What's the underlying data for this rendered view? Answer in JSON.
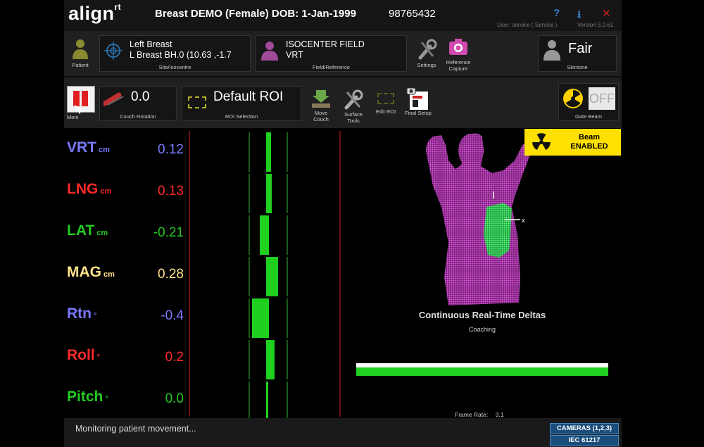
{
  "app": {
    "logo": "align",
    "logo_sup": "rt",
    "patient_title": "Breast DEMO (Female) DOB: 1-Jan-1999",
    "patient_id": "98765432",
    "user_info": "User: service  ( Service )",
    "version": "Version 5.0.61",
    "help_glyph": "?",
    "download_glyph": "⭳",
    "close_glyph": "✕"
  },
  "toolbar1": {
    "patient_label": "Patient",
    "site_line1": "Left Breast",
    "site_line2": "L Breast BH.0  (10.63 ,-1.7",
    "site_label": "Site/Isocentre",
    "field_line1": "ISOCENTER FIELD",
    "field_line2": "VRT",
    "field_label": "Field/Reference",
    "settings_label": "Settings",
    "refcap_label1": "Reference",
    "refcap_label2": "Capture",
    "skintone_value": "Fair",
    "skintone_label": "Skintone"
  },
  "toolbar2": {
    "monitor_label": "Moni",
    "couch_rotation_value": "0.0",
    "couch_rotation_label": "Couch Rotation",
    "roi_value": "Default ROI",
    "roi_label": "ROI Selection",
    "move_couch_1": "Move",
    "move_couch_2": "Couch",
    "surface_tools_1": "Surface",
    "surface_tools_2": "Tools",
    "edit_roi": "Edit ROI",
    "final_setup": "Final Setup",
    "gate_off": "OFF",
    "gate_label": "Gate Beam"
  },
  "metrics": [
    {
      "label": "VRT",
      "unit": "cm",
      "value": "0.12",
      "color": "#7a7aff",
      "bar": 0.12
    },
    {
      "label": "LNG",
      "unit": "cm",
      "value": "0.13",
      "color": "#ff2a2a",
      "bar": 0.13
    },
    {
      "label": "LAT",
      "unit": "cm",
      "value": "-0.21",
      "color": "#22cc22",
      "bar": -0.21
    },
    {
      "label": "MAG",
      "unit": "cm",
      "value": "0.28",
      "color": "#ffe28a",
      "bar": 0.28
    },
    {
      "label": "Rtn",
      "unit": "°",
      "value": "-0.4",
      "color": "#7a7aff",
      "bar": -0.4
    },
    {
      "label": "Roll",
      "unit": "°",
      "value": "0.2",
      "color": "#ff2a2a",
      "bar": 0.2
    },
    {
      "label": "Pitch",
      "unit": "°",
      "value": "0.0",
      "color": "#22cc22",
      "bar": 0.0
    }
  ],
  "beam": {
    "line1": "Beam",
    "line2": "ENABLED"
  },
  "viewport": {
    "title": "Continuous Real-Time Deltas",
    "coaching": "Coaching",
    "frame_rate_label": "Frame Rate:",
    "frame_rate_value": "3.1",
    "axis_x": "x",
    "axis_y": "y"
  },
  "status": {
    "message": "Monitoring patient movement...",
    "cameras": "CAMERAS (1,2,3)",
    "iec": "IEC 61217"
  },
  "colors": {
    "accent_green": "#1fd01f",
    "beam_yellow": "#ffe000",
    "point_cloud": "#c23cc2",
    "badge_blue": "#1a4d7a"
  }
}
